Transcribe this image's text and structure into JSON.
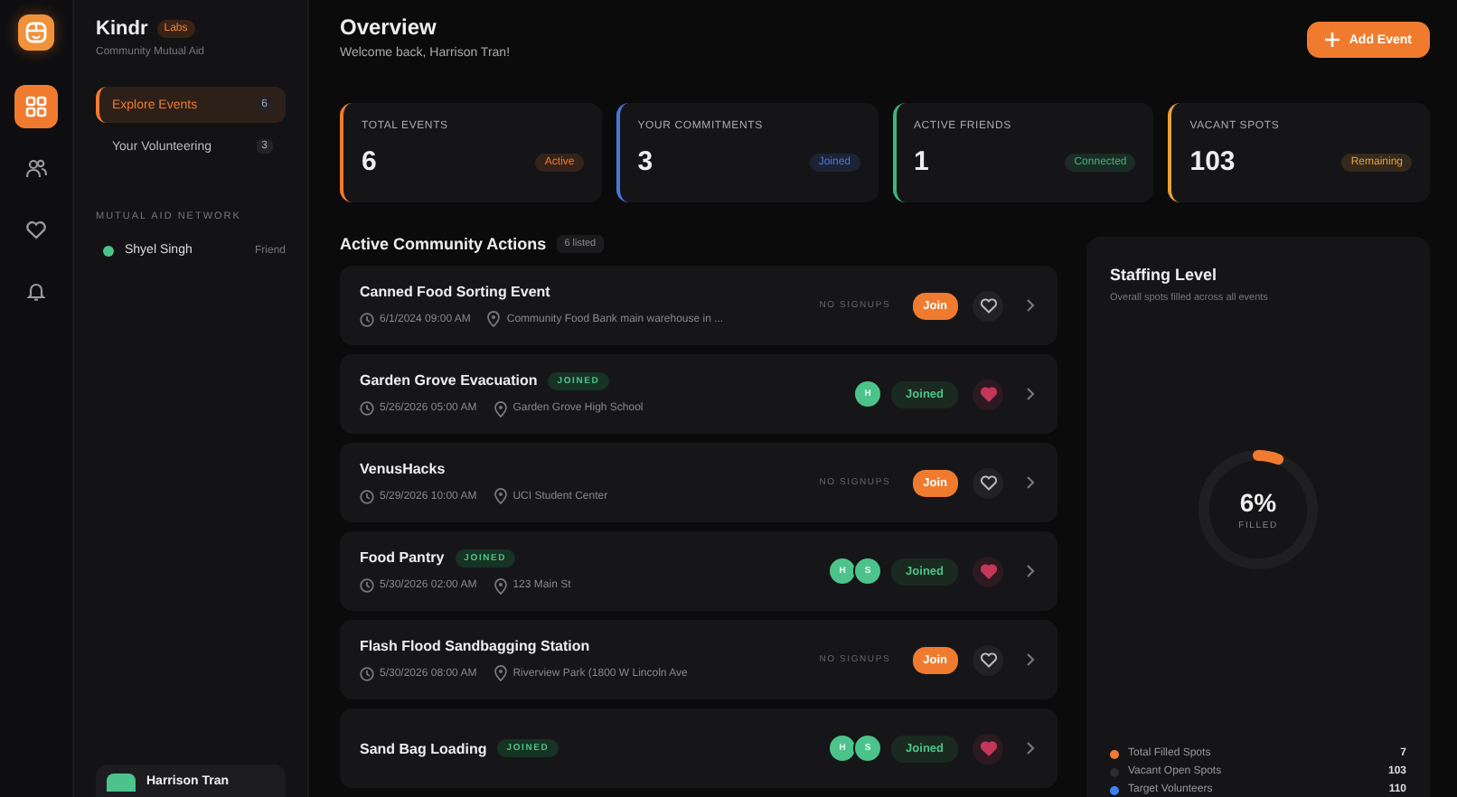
{
  "brand": {
    "name": "Kindr",
    "badge": "Labs",
    "tagline": "Community Mutual Aid"
  },
  "rail": [
    {
      "kind": "grid",
      "selected": true
    },
    {
      "kind": "people",
      "selected": false
    },
    {
      "kind": "heart",
      "selected": false
    },
    {
      "kind": "bell",
      "selected": false
    }
  ],
  "nav": [
    {
      "label": "Explore Events",
      "count": "6",
      "selected": true
    },
    {
      "label": "Your Volunteering",
      "count": "3",
      "selected": false
    }
  ],
  "network": {
    "heading": "MUTUAL AID NETWORK",
    "people": [
      {
        "name": "Shyel Singh",
        "role": "Friend",
        "color": "#4cc38a"
      }
    ]
  },
  "user": {
    "name": "Harrison Tran"
  },
  "header": {
    "title": "Overview",
    "subtitle": "Welcome back, Harrison Tran!",
    "button": "Add Event"
  },
  "stats": [
    {
      "label": "TOTAL EVENTS",
      "value": "6",
      "tag": "Active",
      "color": "#f07b2f"
    },
    {
      "label": "YOUR COMMITMENTS",
      "value": "3",
      "tag": "Joined",
      "color": "#4a78e0"
    },
    {
      "label": "ACTIVE FRIENDS",
      "value": "1",
      "tag": "Connected",
      "color": "#3fb57a"
    },
    {
      "label": "VACANT SPOTS",
      "value": "103",
      "tag": "Remaining",
      "color": "#e8a23a"
    }
  ],
  "actions": {
    "title": "Active Community Actions",
    "count": "6 listed",
    "events": [
      {
        "title": "Canned Food Sorting Event",
        "joined": false,
        "date": "6/1/2024 09:00 AM",
        "location": "Community Food Bank main warehouse in ...",
        "note": "NO SIGNUPS",
        "button": "Join",
        "favorite": false
      },
      {
        "title": "Garden Grove Evacuation",
        "joined": true,
        "badge": "JOINED",
        "date": "5/26/2026 05:00 AM",
        "location": "Garden Grove High School",
        "avatars": [
          "H"
        ],
        "button": "Joined",
        "favorite": true
      },
      {
        "title": "VenusHacks",
        "joined": false,
        "date": "5/29/2026 10:00 AM",
        "location": "UCI Student Center",
        "note": "NO SIGNUPS",
        "button": "Join",
        "favorite": false
      },
      {
        "title": "Food Pantry",
        "joined": true,
        "badge": "JOINED",
        "date": "5/30/2026 02:00 AM",
        "location": "123 Main St",
        "avatars": [
          "H",
          "S"
        ],
        "button": "Joined",
        "favorite": true
      },
      {
        "title": "Flash Flood Sandbagging Station",
        "joined": false,
        "date": "5/30/2026 08:00 AM",
        "location": "Riverview Park (1800 W Lincoln Ave",
        "note": "NO SIGNUPS",
        "button": "Join",
        "favorite": false
      },
      {
        "title": "Sand Bag Loading",
        "joined": true,
        "badge": "JOINED",
        "avatars": [
          "H",
          "S"
        ],
        "button": "Joined",
        "favorite": true
      }
    ]
  },
  "staffing": {
    "title": "Staffing Level",
    "subtitle": "Overall spots filled across all events",
    "percent": "6%",
    "caption": "FILLED",
    "level": 0.06,
    "legend": [
      {
        "label": "Total Filled Spots",
        "value": "7",
        "color": "#f07b2f"
      },
      {
        "label": "Vacant Open Spots",
        "value": "103",
        "color": "#2c2c30"
      },
      {
        "label": "Target Volunteers",
        "value": "110",
        "color": "#3b82f6"
      }
    ]
  }
}
